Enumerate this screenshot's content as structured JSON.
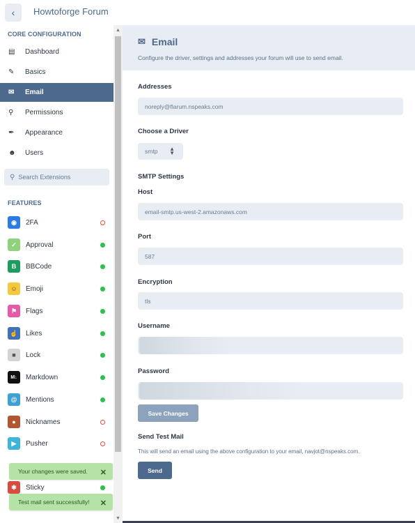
{
  "header": {
    "back_icon": "chevron-left-icon",
    "title": "Howtoforge Forum"
  },
  "sidebar": {
    "core_title": "CORE CONFIGURATION",
    "core_items": [
      {
        "label": "Dashboard",
        "icon": "chart-icon",
        "active": false
      },
      {
        "label": "Basics",
        "icon": "pencil-icon",
        "active": false
      },
      {
        "label": "Email",
        "icon": "envelope-icon",
        "active": true
      },
      {
        "label": "Permissions",
        "icon": "key-icon",
        "active": false
      },
      {
        "label": "Appearance",
        "icon": "brush-icon",
        "active": false
      },
      {
        "label": "Users",
        "icon": "users-icon",
        "active": false
      }
    ],
    "search_placeholder": "Search Extensions",
    "features_title": "FEATURES",
    "extensions": [
      {
        "label": "2FA",
        "enabled": false,
        "icon_color": "#2a7be4"
      },
      {
        "label": "Approval",
        "enabled": true,
        "icon_color": "#8fd17c"
      },
      {
        "label": "BBCode",
        "enabled": true,
        "icon_color": "#1e9b5e"
      },
      {
        "label": "Emoji",
        "enabled": true,
        "icon_color": "#f6c842"
      },
      {
        "label": "Flags",
        "enabled": true,
        "icon_color": "#e75aa8"
      },
      {
        "label": "Likes",
        "enabled": true,
        "icon_color": "#3f71bd"
      },
      {
        "label": "Lock",
        "enabled": true,
        "icon_color": "#d4d4d4"
      },
      {
        "label": "Markdown",
        "enabled": true,
        "icon_color": "#111111"
      },
      {
        "label": "Mentions",
        "enabled": true,
        "icon_color": "#3ea1d6"
      },
      {
        "label": "Nicknames",
        "enabled": false,
        "icon_color": "#b3552f"
      },
      {
        "label": "Pusher",
        "enabled": false,
        "icon_color": "#3fb4d9"
      },
      {
        "label": "Sticky",
        "enabled": true,
        "icon_color": "#d94b3f"
      }
    ]
  },
  "main": {
    "title": "Email",
    "description": "Configure the driver, settings and addresses your forum will use to send email.",
    "addresses_label": "Addresses",
    "addresses_value": "noreply@flarum.nspeaks.com",
    "driver_label": "Choose a Driver",
    "driver_value": "smtp",
    "smtp_label": "SMTP Settings",
    "host_label": "Host",
    "host_value": "email-smtp.us-west-2.amazonaws.com",
    "port_label": "Port",
    "port_value": "587",
    "encryption_label": "Encryption",
    "encryption_value": "tls",
    "username_label": "Username",
    "password_label": "Password",
    "save_label": "Save Changes",
    "test_title": "Send Test Mail",
    "test_desc": "This will send an email using the above configuration to your email, navjot@nspeaks.com.",
    "send_label": "Send"
  },
  "toasts": [
    {
      "text": "Your changes were saved."
    },
    {
      "text": "Test mail sent successfully!"
    }
  ],
  "colors": {
    "accent": "#4d698e",
    "light": "#e7edf3",
    "success": "#b5e3a5"
  }
}
